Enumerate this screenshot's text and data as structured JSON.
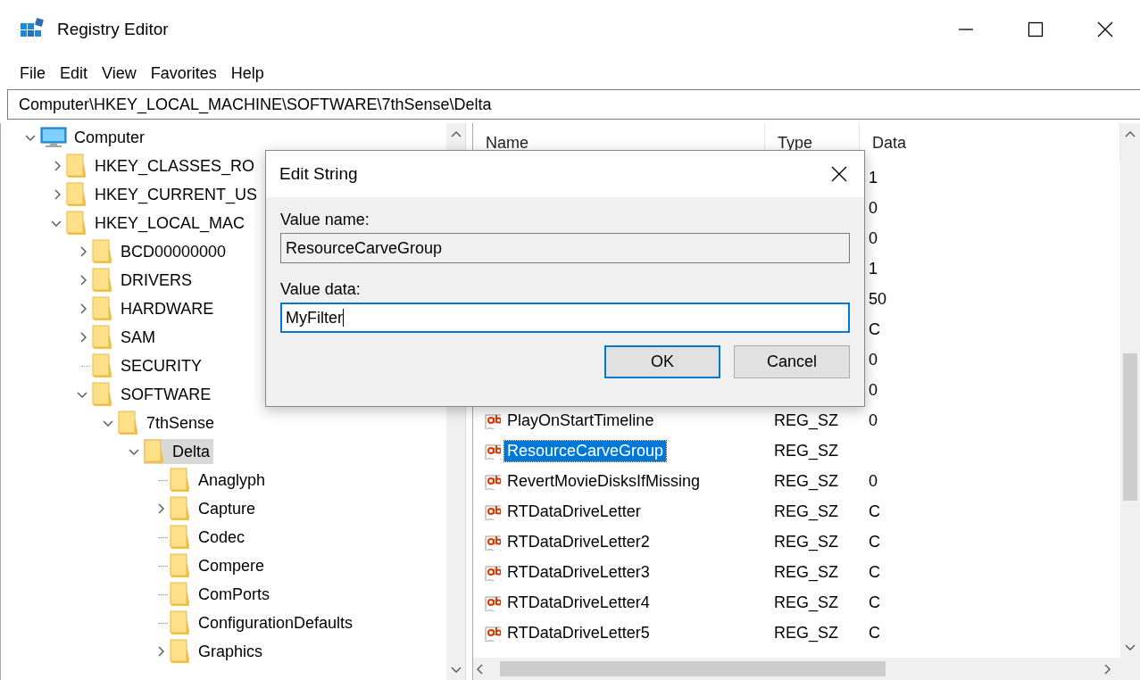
{
  "window": {
    "title": "Registry Editor"
  },
  "menu": [
    "File",
    "Edit",
    "View",
    "Favorites",
    "Help"
  ],
  "address": "Computer\\HKEY_LOCAL_MACHINE\\SOFTWARE\\7thSense\\Delta",
  "tree": {
    "items": [
      {
        "label": "Computer",
        "kind": "computer",
        "expandable": true,
        "expanded": true,
        "selected": false,
        "children": [
          {
            "label": "HKEY_CLASSES_RO",
            "kind": "folder",
            "expandable": true,
            "expanded": false,
            "selected": false
          },
          {
            "label": "HKEY_CURRENT_US",
            "kind": "folder",
            "expandable": true,
            "expanded": false,
            "selected": false
          },
          {
            "label": "HKEY_LOCAL_MAC",
            "kind": "folder",
            "expandable": true,
            "expanded": true,
            "selected": false,
            "children": [
              {
                "label": "BCD00000000",
                "kind": "folder",
                "expandable": true,
                "expanded": false,
                "selected": false
              },
              {
                "label": "DRIVERS",
                "kind": "folder",
                "expandable": true,
                "expanded": false,
                "selected": false
              },
              {
                "label": "HARDWARE",
                "kind": "folder",
                "expandable": true,
                "expanded": false,
                "selected": false
              },
              {
                "label": "SAM",
                "kind": "folder",
                "expandable": true,
                "expanded": false,
                "selected": false
              },
              {
                "label": "SECURITY",
                "kind": "folder",
                "expandable": false,
                "selected": false
              },
              {
                "label": "SOFTWARE",
                "kind": "folder",
                "expandable": true,
                "expanded": true,
                "selected": false,
                "children": [
                  {
                    "label": "7thSense",
                    "kind": "folder",
                    "expandable": true,
                    "expanded": true,
                    "selected": false,
                    "children": [
                      {
                        "label": "Delta",
                        "kind": "folder",
                        "expandable": true,
                        "expanded": true,
                        "selected": true,
                        "children": [
                          {
                            "label": "Anaglyph",
                            "kind": "folder",
                            "expandable": false,
                            "selected": false
                          },
                          {
                            "label": "Capture",
                            "kind": "folder",
                            "expandable": true,
                            "expanded": false,
                            "selected": false
                          },
                          {
                            "label": "Codec",
                            "kind": "folder",
                            "expandable": false,
                            "selected": false
                          },
                          {
                            "label": "Compere",
                            "kind": "folder",
                            "expandable": false,
                            "selected": false
                          },
                          {
                            "label": "ComPorts",
                            "kind": "folder",
                            "expandable": false,
                            "selected": false
                          },
                          {
                            "label": "ConfigurationDefaults",
                            "kind": "folder",
                            "expandable": false,
                            "selected": false
                          },
                          {
                            "label": "Graphics",
                            "kind": "folder",
                            "expandable": true,
                            "expanded": false,
                            "selected": false
                          }
                        ]
                      }
                    ]
                  }
                ]
              }
            ]
          }
        ]
      }
    ]
  },
  "list": {
    "columns": [
      "Name",
      "Type",
      "Data"
    ],
    "rows": [
      {
        "data": "1",
        "selected": false
      },
      {
        "data": "0",
        "selected": false
      },
      {
        "data": "0",
        "selected": false
      },
      {
        "data": "1",
        "selected": false
      },
      {
        "data": "50",
        "selected": false
      },
      {
        "data": "C",
        "selected": false
      },
      {
        "data": "0",
        "selected": false
      },
      {
        "data": "0",
        "selected": false
      },
      {
        "name": "PlayOnStartTimeline",
        "type": "REG_SZ",
        "data": "0",
        "selected": false
      },
      {
        "name": "ResourceCarveGroup",
        "type": "REG_SZ",
        "selected": true
      },
      {
        "name": "RevertMovieDisksIfMissing",
        "type": "REG_SZ",
        "data": "0",
        "selected": false
      },
      {
        "name": "RTDataDriveLetter",
        "type": "REG_SZ",
        "data": "C",
        "selected": false
      },
      {
        "name": "RTDataDriveLetter2",
        "type": "REG_SZ",
        "data": "C",
        "selected": false
      },
      {
        "name": "RTDataDriveLetter3",
        "type": "REG_SZ",
        "data": "C",
        "selected": false
      },
      {
        "name": "RTDataDriveLetter4",
        "type": "REG_SZ",
        "data": "C",
        "selected": false
      },
      {
        "name": "RTDataDriveLetter5",
        "type": "REG_SZ",
        "data": "C",
        "selected": false
      }
    ]
  },
  "dialog": {
    "title": "Edit String",
    "value_name_label": "Value name:",
    "value_name": "ResourceCarveGroup",
    "value_data_label": "Value data:",
    "value_data": "MyFilter",
    "buttons": [
      {
        "label": "OK",
        "default": true
      },
      {
        "label": "Cancel",
        "default": false
      }
    ]
  }
}
